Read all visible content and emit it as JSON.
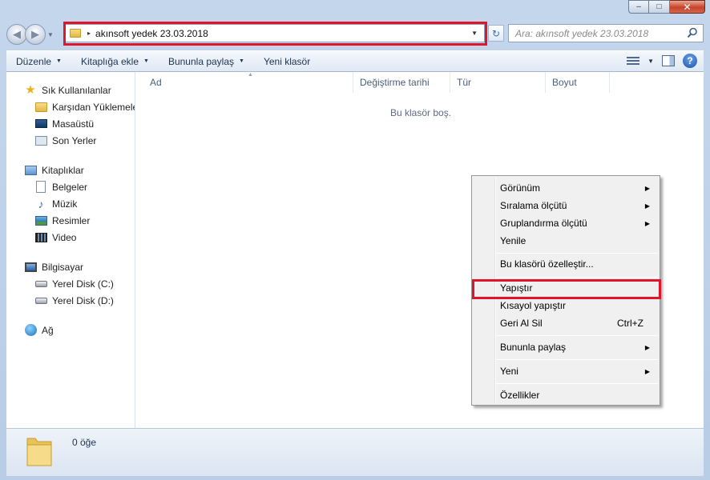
{
  "window": {
    "minimize_glyph": "–",
    "maximize_glyph": "□",
    "close_glyph": "✕"
  },
  "navbar": {
    "back_glyph": "◀",
    "forward_glyph": "▶",
    "breadcrumb_separator": "▸",
    "address_path": "akınsoft yedek 23.03.2018",
    "dropdown_glyph": "▼",
    "refresh_glyph": "↻",
    "search_placeholder": "Ara: akınsoft yedek 23.03.2018"
  },
  "toolbar": {
    "organize": "Düzenle",
    "include_in_library": "Kitaplığa ekle",
    "share_with": "Bununla paylaş",
    "new_folder": "Yeni klasör",
    "dropdown_glyph": "▼",
    "help_glyph": "?"
  },
  "sidebar": {
    "favorites": {
      "label": "Sık Kullanılanlar",
      "items": [
        {
          "label": "Karşıdan Yüklemeler",
          "icon": "downloads-folder-icon"
        },
        {
          "label": "Masaüstü",
          "icon": "desktop-icon"
        },
        {
          "label": "Son Yerler",
          "icon": "recent-places-icon"
        }
      ]
    },
    "libraries": {
      "label": "Kitaplıklar",
      "items": [
        {
          "label": "Belgeler",
          "icon": "documents-icon"
        },
        {
          "label": "Müzik",
          "icon": "music-icon"
        },
        {
          "label": "Resimler",
          "icon": "pictures-icon"
        },
        {
          "label": "Video",
          "icon": "video-icon"
        }
      ]
    },
    "computer": {
      "label": "Bilgisayar",
      "items": [
        {
          "label": "Yerel Disk (C:)",
          "icon": "local-disk-c-icon"
        },
        {
          "label": "Yerel Disk (D:)",
          "icon": "local-disk-d-icon"
        }
      ]
    },
    "network": {
      "label": "Ağ",
      "icon": "network-icon"
    }
  },
  "content": {
    "columns": [
      "Ad",
      "Değiştirme tarihi",
      "Tür",
      "Boyut"
    ],
    "sort_glyph": "▲",
    "empty_message": "Bu klasör boş."
  },
  "status": {
    "item_count": "0 öğe"
  },
  "context_menu": {
    "items": [
      {
        "label": "Görünüm",
        "submenu": true
      },
      {
        "label": "Sıralama ölçütü",
        "submenu": true
      },
      {
        "label": "Gruplandırma ölçütü",
        "submenu": true
      },
      {
        "label": "Yenile"
      },
      {
        "label": "Bu klasörü özelleştir..."
      },
      {
        "label": "Yapıştır"
      },
      {
        "label": "Kısayol yapıştır"
      },
      {
        "label": "Geri Al Sil",
        "shortcut": "Ctrl+Z"
      },
      {
        "label": "Bununla paylaş",
        "submenu": true
      },
      {
        "label": "Yeni",
        "submenu": true
      },
      {
        "label": "Özellikler"
      }
    ],
    "submenu_glyph": "▶"
  },
  "colors": {
    "highlight_box": "#e0152a",
    "window_frame": "#c4d6ec",
    "menu_background": "#f0f0f0"
  }
}
